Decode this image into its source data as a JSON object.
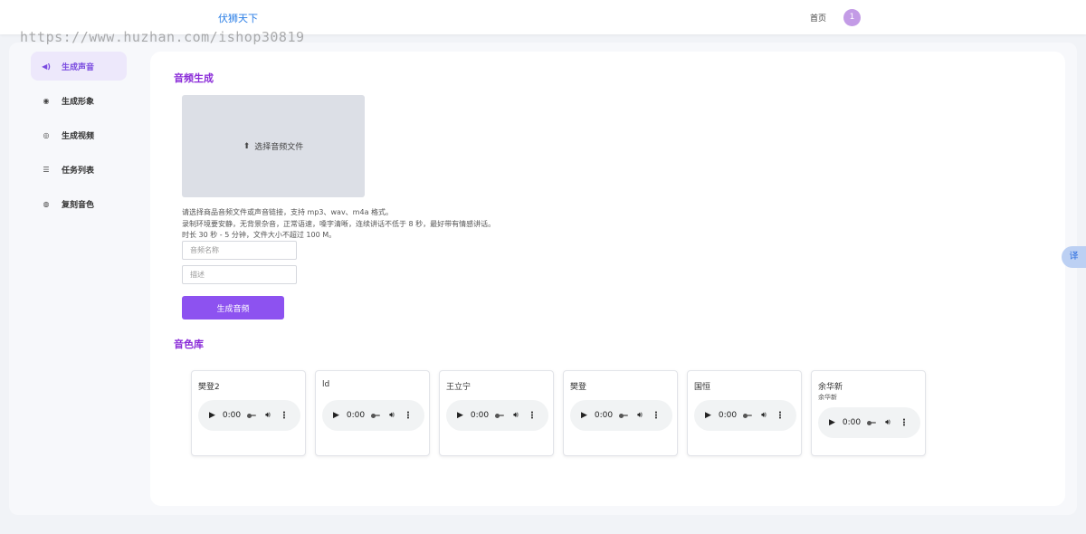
{
  "header": {
    "brand": "伏狮天下",
    "watermark": "https://www.huzhan.com/ishop30819",
    "nav_home": "首页",
    "avatar_text": "1"
  },
  "sidebar": {
    "items": [
      {
        "label": "生成声音",
        "icon": "speaker-icon",
        "glyph": "◀)",
        "active": true
      },
      {
        "label": "生成形象",
        "icon": "user-circle-icon",
        "glyph": "◉",
        "active": false
      },
      {
        "label": "生成视频",
        "icon": "video-disc-icon",
        "glyph": "◎",
        "active": false
      },
      {
        "label": "任务列表",
        "icon": "list-icon",
        "glyph": "☰",
        "active": false
      },
      {
        "label": "复刻音色",
        "icon": "clone-voice-icon",
        "glyph": "◍",
        "active": false
      }
    ]
  },
  "audio_gen": {
    "title": "音频生成",
    "upload_label": "选择音频文件",
    "hint_lines": [
      "请选择商品音频文件或声音链接，支持 mp3、wav、m4a 格式。",
      "录制环境要安静，无背景杂音，正常语速，嗓字清晰，连续讲话不低于 8 秒，最好带有情感讲话。",
      "时长 30 秒 - 5 分钟，文件大小不超过 100 M。"
    ],
    "name_placeholder": "音频名称",
    "desc_placeholder": "描述",
    "submit_label": "生成音频"
  },
  "library": {
    "title": "音色库",
    "voices": [
      {
        "name": "樊登2",
        "sub": "",
        "time": "0:00"
      },
      {
        "name": "ld",
        "sub": "",
        "time": "0:00"
      },
      {
        "name": "王立宁",
        "sub": "",
        "time": "0:00"
      },
      {
        "name": "樊登",
        "sub": "",
        "time": "0:00"
      },
      {
        "name": "国恒",
        "sub": "",
        "time": "0:00"
      },
      {
        "name": "余华新",
        "sub": "余华新",
        "time": "0:00"
      }
    ]
  },
  "translate_label": "译",
  "colors": {
    "accent": "#8d52f0",
    "brand": "#2a7ee6",
    "section_title": "#8a2bd8",
    "active_bg": "#ede8fb"
  }
}
